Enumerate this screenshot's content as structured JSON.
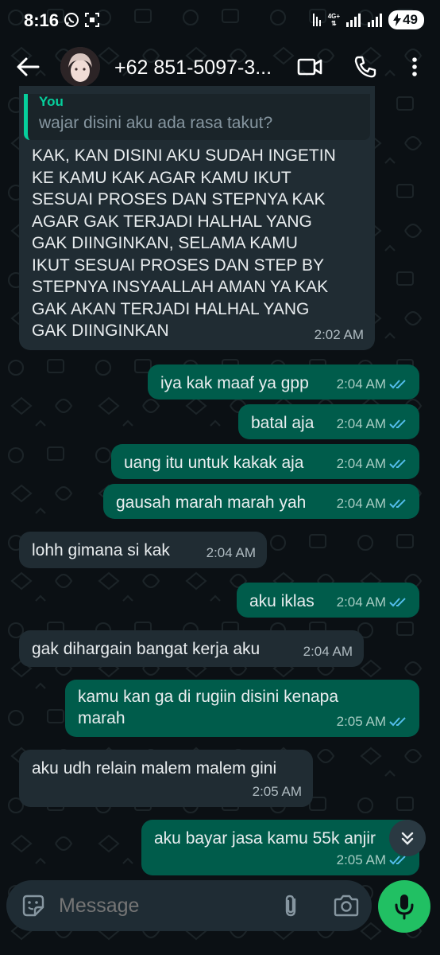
{
  "status_bar": {
    "time": "8:16",
    "network": "4G+",
    "battery": "49"
  },
  "header": {
    "contact_name": "+62 851-5097-3..."
  },
  "quoted": {
    "sender": "You",
    "text": "wajar disini aku ada rasa takut?"
  },
  "messages": [
    {
      "dir": "in",
      "lines": [
        "KAK, KAN DISINI AKU SUDAH INGETIN",
        "KE KAMU KAK AGAR KAMU IKUT",
        "SESUAI PROSES DAN STEPNYA KAK",
        "AGAR GAK TERJADI HALHAL YANG",
        "GAK DIINGINKAN, SELAMA KAMU",
        "IKUT SESUAI PROSES DAN STEP BY",
        "STEPNYA INSYAALLAH AMAN YA KAK",
        "GAK AKAN TERJADI HALHAL YANG",
        "GAK DIINGINKAN"
      ],
      "time": "2:02 AM"
    },
    {
      "dir": "out",
      "text": "iya kak maaf ya gpp",
      "time": "2:04 AM"
    },
    {
      "dir": "out",
      "text": "batal aja",
      "time": "2:04 AM"
    },
    {
      "dir": "out",
      "text": "uang itu untuk kakak aja",
      "time": "2:04 AM"
    },
    {
      "dir": "out",
      "text": "gausah marah marah yah",
      "time": "2:04 AM"
    },
    {
      "dir": "in",
      "text": "lohh gimana si kak",
      "time": "2:04 AM"
    },
    {
      "dir": "out",
      "text": "aku iklas",
      "time": "2:04 AM"
    },
    {
      "dir": "in",
      "text": "gak dihargain bangat kerja aku",
      "time": "2:04 AM"
    },
    {
      "dir": "out",
      "lines": [
        "kamu kan ga di rugiin disini kenapa",
        "marah"
      ],
      "time": "2:05 AM"
    },
    {
      "dir": "in",
      "text": "aku udh relain malem malem gini",
      "time": "2:05 AM"
    },
    {
      "dir": "out",
      "text": "aku bayar jasa kamu 55k anjir",
      "time": "2:05 AM"
    }
  ],
  "input": {
    "placeholder": "Message"
  },
  "colors": {
    "incoming": "#202c33",
    "outgoing": "#005c4b",
    "accent": "#21c063",
    "read_ticks": "#53bdeb"
  },
  "icons": [
    "back-arrow-icon",
    "video-call-icon",
    "voice-call-icon",
    "more-options-icon",
    "emoji-icon",
    "attach-icon",
    "camera-icon",
    "mic-icon",
    "scroll-down-icon",
    "double-check-icon"
  ]
}
